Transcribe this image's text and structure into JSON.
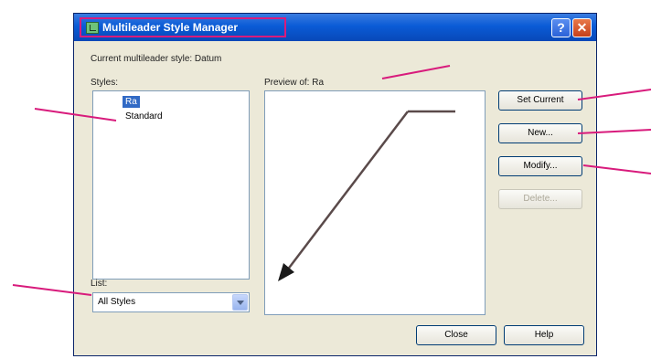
{
  "dialog": {
    "title": "Multileader Style Manager",
    "help_glyph": "?",
    "close_glyph": "✕",
    "current_style_label": "Current multileader style: Datum",
    "styles_label": "Styles:",
    "styles": [
      {
        "label": "Ra",
        "selected": true
      },
      {
        "label": "Standard",
        "selected": false
      }
    ],
    "list_label": "List:",
    "list_value": "All Styles",
    "preview_label": "Preview of: Ra",
    "buttons": {
      "set_current": "Set Current",
      "new": "New...",
      "modify": "Modify...",
      "delete": "Delete..."
    },
    "footer": {
      "close": "Close",
      "help": "Help"
    }
  },
  "colors": {
    "titlebar": "#0a5bd6",
    "dialog_bg": "#ece9d8",
    "selection": "#316ac5",
    "callout": "#d81b7c",
    "leader": "#5a4a4a"
  },
  "icons": [
    "app-icon",
    "help-icon",
    "close-icon",
    "chevron-down-icon",
    "arrowhead-icon"
  ]
}
